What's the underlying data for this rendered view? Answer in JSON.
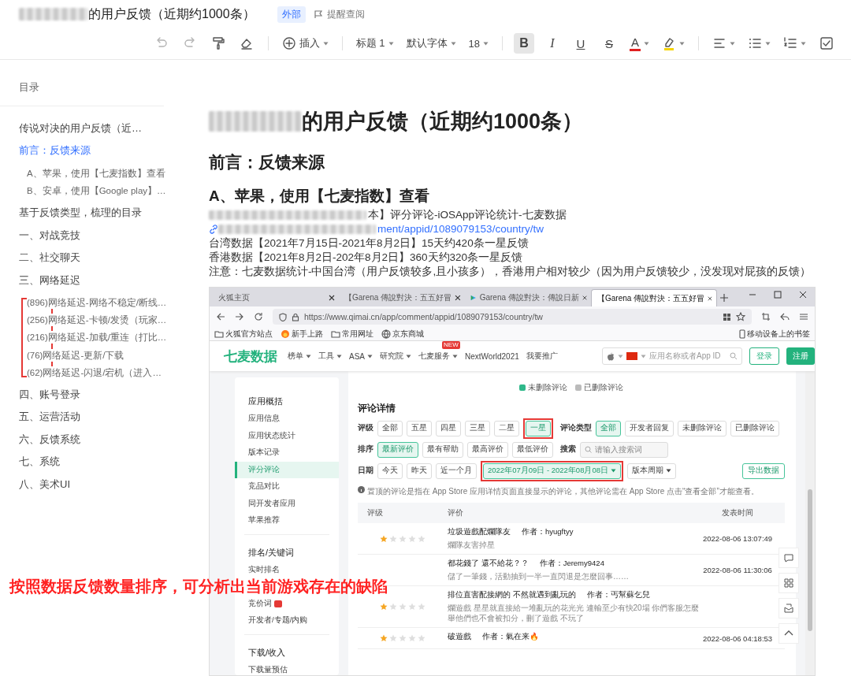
{
  "header": {
    "redacted": true,
    "title": "的用户反馈（近期约1000条）",
    "badge": "外部",
    "remind": "提醒查阅"
  },
  "toolbar": [
    [
      {
        "kind": "undo",
        "disabled": true
      },
      {
        "kind": "redo",
        "disabled": true
      },
      {
        "kind": "format-painter",
        "disabled": false
      },
      {
        "kind": "eraser",
        "disabled": false
      }
    ],
    [
      {
        "kind": "insert",
        "label": "插入"
      }
    ],
    [
      {
        "kind": "dropdown",
        "label": "标题 1"
      },
      {
        "kind": "dropdown",
        "label": "默认字体"
      },
      {
        "kind": "dropdown",
        "label": "18"
      }
    ],
    [
      {
        "kind": "bold",
        "label": "B",
        "active": true
      },
      {
        "kind": "italic",
        "label": "I",
        "active": false
      },
      {
        "kind": "underline",
        "label": "U",
        "active": false
      },
      {
        "kind": "strike",
        "label": "S",
        "active": false
      },
      {
        "kind": "font-color",
        "label": "A",
        "color": "#e02020",
        "active": false
      },
      {
        "kind": "highlight",
        "color": "#f5d400",
        "active": false
      }
    ],
    [
      {
        "kind": "align"
      },
      {
        "kind": "bullets"
      },
      {
        "kind": "numbers"
      },
      {
        "kind": "checklist"
      }
    ]
  ],
  "toc": {
    "heading": "目录",
    "items": [
      {
        "text": "传说对决的用户反馈（近…",
        "selected": false,
        "annotated": false
      },
      {
        "text": "前言：反馈来源",
        "selected": true,
        "annotated": false,
        "children": [
          {
            "text": "A、苹果，使用【七麦指数】查看",
            "selected": false
          },
          {
            "text": "B、安卓，使用【Google play】…",
            "selected": false
          }
        ]
      },
      {
        "text": "基于反馈类型，梳理的目录",
        "selected": false,
        "annotated": false
      },
      {
        "text": "一、对战竞技",
        "selected": false,
        "annotated": false
      },
      {
        "text": "二、社交聊天",
        "selected": false,
        "annotated": false
      },
      {
        "text": "三、网络延迟",
        "selected": false,
        "annotated": true,
        "children": [
          {
            "text": "(896)网络延迟-网络不稳定/断线…",
            "selected": false
          },
          {
            "text": "(256)网络延迟-卡顿/发烫（玩家…",
            "selected": false
          },
          {
            "text": "(216)网络延迟-加载/重连（打比…",
            "selected": false
          },
          {
            "text": "(76)网络延迟-更新/下载",
            "selected": false
          },
          {
            "text": "(62)网络延迟-闪退/宕机（进入…",
            "selected": false
          }
        ]
      },
      {
        "text": "四、账号登录",
        "selected": false,
        "annotated": false
      },
      {
        "text": "五、运营活动",
        "selected": false,
        "annotated": false
      },
      {
        "text": "六、反馈系统",
        "selected": false,
        "annotated": false
      },
      {
        "text": "七、系统",
        "selected": false,
        "annotated": false
      },
      {
        "text": "八、美术UI",
        "selected": false,
        "annotated": false
      }
    ]
  },
  "doc": {
    "h1": {
      "text": "的用户反馈（近期约1000条）",
      "redacted": true
    },
    "h2": "前言：反馈来源",
    "h3": "A、苹果，使用【七麦指数】查看",
    "lines": [
      {
        "kind": "text",
        "text": "本】评分评论-iOSApp评论统计-七麦数据",
        "redacted": true
      },
      {
        "kind": "link",
        "text": "ment/appid/1089079153/country/tw",
        "redacted": true
      },
      {
        "kind": "text",
        "text": "台湾数据【2021年7月15日-2021年8月2日】15天约420条一星反馈",
        "redacted": false
      },
      {
        "kind": "text",
        "text": "香港数据【2021年8月2日-202年8月2日】360天约320条一星反馈",
        "redacted": false
      },
      {
        "kind": "text",
        "text": "注意：七麦数据统计-中国台湾（用户反馈较多,且小孩多），香港用户相对较少（因为用户反馈较少，没发现对屁孩的反馈）",
        "redacted": false
      }
    ]
  },
  "screenshot": {
    "tabs": [
      {
        "title": "火狐主页",
        "kind": "plain",
        "selected": false
      },
      {
        "title": "【Garena 傳說對決：五五好冒",
        "kind": "plain",
        "selected": false
      },
      {
        "title": "Garena 傳說對決：傳說日新",
        "kind": "play",
        "selected": false
      },
      {
        "title": "【Garena 傳說對決：五五好冒",
        "kind": "plain",
        "selected": true
      }
    ],
    "url": "https://www.qimai.cn/app/comment/appid/1089079153/country/tw",
    "bookmarks": [
      {
        "label": "火狐官方站点",
        "kind": "folder"
      },
      {
        "label": "新手上路",
        "kind": "fox"
      },
      {
        "label": "常用网址",
        "kind": "folder"
      },
      {
        "label": "京东商城",
        "kind": "globe"
      }
    ],
    "mobile_bookmarks": "移动设备上的书签",
    "logo": "七麦数据",
    "nav": [
      {
        "label": "榜单",
        "dropdown": true
      },
      {
        "label": "工具",
        "dropdown": true
      },
      {
        "label": "ASA",
        "dropdown": true
      },
      {
        "label": "研究院",
        "dropdown": true
      },
      {
        "label": "七麦服务",
        "dropdown": true,
        "badge": "NEW"
      },
      {
        "label": "NextWorld2021",
        "dropdown": false
      },
      {
        "label": "我要推广",
        "dropdown": false
      }
    ],
    "search_placeholder": "应用名称或者App ID",
    "login": "登录",
    "register": "注册",
    "menu": [
      {
        "title": "应用概括",
        "items": [
          {
            "label": "应用信息",
            "selected": false
          },
          {
            "label": "应用状态统计",
            "selected": false
          },
          {
            "label": "版本记录",
            "selected": false
          },
          {
            "label": "评分评论",
            "selected": true
          },
          {
            "label": "竞品对比",
            "selected": false
          },
          {
            "label": "同开发者应用",
            "selected": false
          },
          {
            "label": "苹果推荐",
            "selected": false
          }
        ]
      },
      {
        "title": "排名/关键词",
        "items": [
          {
            "label": "实时排名",
            "kind": "plain"
          },
          {
            "kind": "covered"
          },
          {
            "label": "竞价词",
            "kind": "badge"
          },
          {
            "label": "开发者/专题/内购",
            "kind": "plain"
          }
        ]
      },
      {
        "title": "下载/收入",
        "items": [
          {
            "label": "下载量预估",
            "kind": "plain"
          }
        ]
      }
    ],
    "legend": [
      {
        "label": "未删除评论",
        "color": "#2fb88a"
      },
      {
        "label": "已删除评论",
        "color": "#bbbbbb"
      }
    ],
    "section_title": "评论详情",
    "filter_rows": [
      [
        {
          "label": "评级",
          "options": [
            {
              "label": "全部",
              "selected": false,
              "annotated": false
            },
            {
              "label": "五星",
              "selected": false,
              "annotated": false
            },
            {
              "label": "四星",
              "selected": false,
              "annotated": false
            },
            {
              "label": "三星",
              "selected": false,
              "annotated": false
            },
            {
              "label": "二星",
              "selected": false,
              "annotated": false
            },
            {
              "label": "一星",
              "selected": true,
              "annotated": true
            }
          ]
        },
        {
          "label": "评论类型",
          "options": [
            {
              "label": "全部",
              "selected": true,
              "annotated": false
            },
            {
              "label": "开发者回复",
              "selected": false,
              "annotated": false
            },
            {
              "label": "未删除评论",
              "selected": false,
              "annotated": false
            },
            {
              "label": "已删除评论",
              "selected": false,
              "annotated": false
            }
          ]
        }
      ],
      [
        {
          "label": "排序",
          "options": [
            {
              "label": "最新评价",
              "selected": true,
              "annotated": false
            },
            {
              "label": "最有帮助",
              "selected": false,
              "annotated": false
            },
            {
              "label": "最高评价",
              "selected": false,
              "annotated": false
            },
            {
              "label": "最低评价",
              "selected": false,
              "annotated": false
            }
          ]
        },
        {
          "label": "搜索",
          "placeholder": "请输入搜索词"
        }
      ],
      [
        {
          "label": "日期",
          "options": [
            {
              "label": "今天",
              "selected": false,
              "annotated": false,
              "dropdown": false
            },
            {
              "label": "昨天",
              "selected": false,
              "annotated": false,
              "dropdown": false
            },
            {
              "label": "近一个月",
              "selected": false,
              "annotated": false,
              "dropdown": false
            },
            {
              "label": "2022年07月09日 - 2022年08月08日",
              "selected": true,
              "annotated": true,
              "dropdown": true
            },
            {
              "label": "版本周期",
              "selected": false,
              "annotated": false,
              "dropdown": true
            }
          ]
        }
      ]
    ],
    "export": "导出数据",
    "note": "置顶的评论是指在 App Store 应用详情页面直接显示的评论，其他评论需在 App Store 点击“查看全部”才能查看。",
    "columns": [
      "评级",
      "评价",
      "发表时间"
    ],
    "rows": [
      {
        "stars": 1,
        "title": "垃圾遊戲配爛隊友",
        "author": "作者：hyugftyy",
        "date": "2022-08-06 13:07:49",
        "excerpt": [
          "爛隊友害掉星"
        ]
      },
      {
        "title": "都花錢了 還不給花？？",
        "author": "作者：Jeremy9424",
        "date": "2022-08-06 11:30:06",
        "excerpt": [
          "儲了一筆錢，活動抽到一半一直閃退是怎麼回事……"
        ]
      },
      {
        "stars": 1,
        "title": "排位直害配接網的 不然就遇到亂玩的",
        "author": "作者：丐幫蘇乞兒",
        "excerpt": [
          "爛遊戲 星星就直接給一堆亂玩的花光光 連輸至少有快20場 你們客服怎麼",
          "舉他們也不會被扣分，刪了遊戲 不玩了"
        ]
      },
      {
        "stars": 1,
        "title": "破遊戲",
        "author": "作者：氣在来🔥",
        "date": "2022-08-06 04:18:53",
        "excerpt": []
      }
    ]
  },
  "annotation": "按照数据反馈数量排序，可分析出当前游戏存在的缺陷"
}
